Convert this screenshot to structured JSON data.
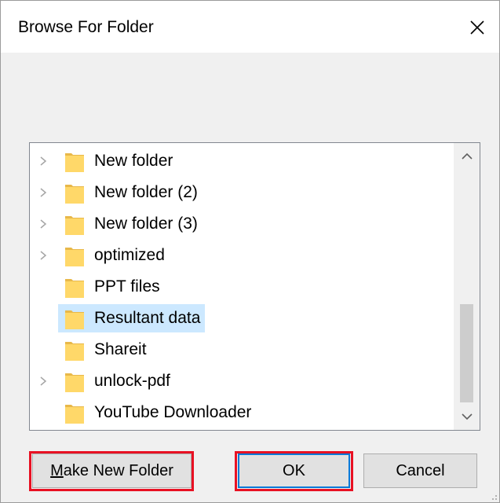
{
  "dialog": {
    "title": "Browse For Folder",
    "close_icon": "close-icon"
  },
  "tree": {
    "items": [
      {
        "label": "New folder",
        "has_children": true,
        "selected": false
      },
      {
        "label": "New folder (2)",
        "has_children": true,
        "selected": false
      },
      {
        "label": "New folder (3)",
        "has_children": true,
        "selected": false
      },
      {
        "label": "optimized",
        "has_children": true,
        "selected": false
      },
      {
        "label": "PPT files",
        "has_children": false,
        "selected": false
      },
      {
        "label": "Resultant data",
        "has_children": false,
        "selected": true
      },
      {
        "label": "Shareit",
        "has_children": false,
        "selected": false
      },
      {
        "label": "unlock-pdf",
        "has_children": true,
        "selected": false
      },
      {
        "label": "YouTube Downloader",
        "has_children": false,
        "selected": false
      }
    ],
    "folder_icon": "folder-icon",
    "expander_icon": "chevron-right-icon"
  },
  "buttons": {
    "make_new_folder_first": "M",
    "make_new_folder_rest": "ake New Folder",
    "ok": "OK",
    "cancel": "Cancel"
  },
  "colors": {
    "selection": "#cce8ff",
    "highlight": "#e81123",
    "focus": "#0078d7",
    "folder": "#ffd869"
  }
}
